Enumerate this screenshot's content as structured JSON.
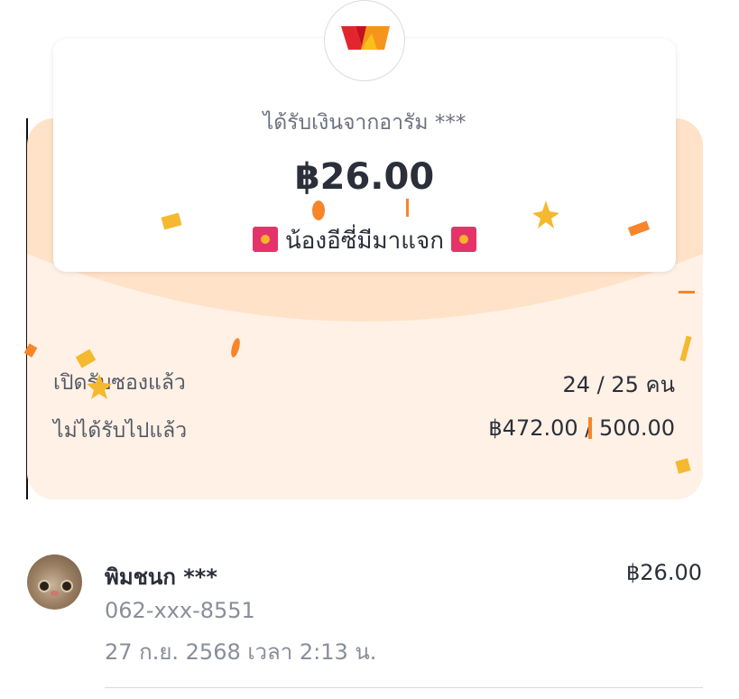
{
  "card": {
    "sender_text": "ได้รับเงินจากอารัม ***",
    "amount": "฿26.00",
    "title": "น้องอีซี่มีมาแจก",
    "logo_icon": "wallet-logo-icon",
    "title_icon": "red-envelope-icon"
  },
  "stats": {
    "opened_label": "เปิดรับซองแล้ว",
    "opened_value": "24 / 25 คน",
    "received_label": "ไม่ได้รับไปแล้ว",
    "received_value": "฿472.00 / 500.00"
  },
  "receivers": [
    {
      "name": "พิมชนก ***",
      "phone": "062-xxx-8551",
      "time": "27 ก.ย. 2568 เวลา 2:13 น.",
      "amount": "฿26.00"
    }
  ],
  "colors": {
    "envelope_top": "#ffe2c7",
    "envelope_bottom": "#fff1e6",
    "confetti_orange": "#f7852a",
    "confetti_yellow": "#f5b82e",
    "text_dark": "#2b2f3a",
    "text_muted": "#8a8e99"
  }
}
